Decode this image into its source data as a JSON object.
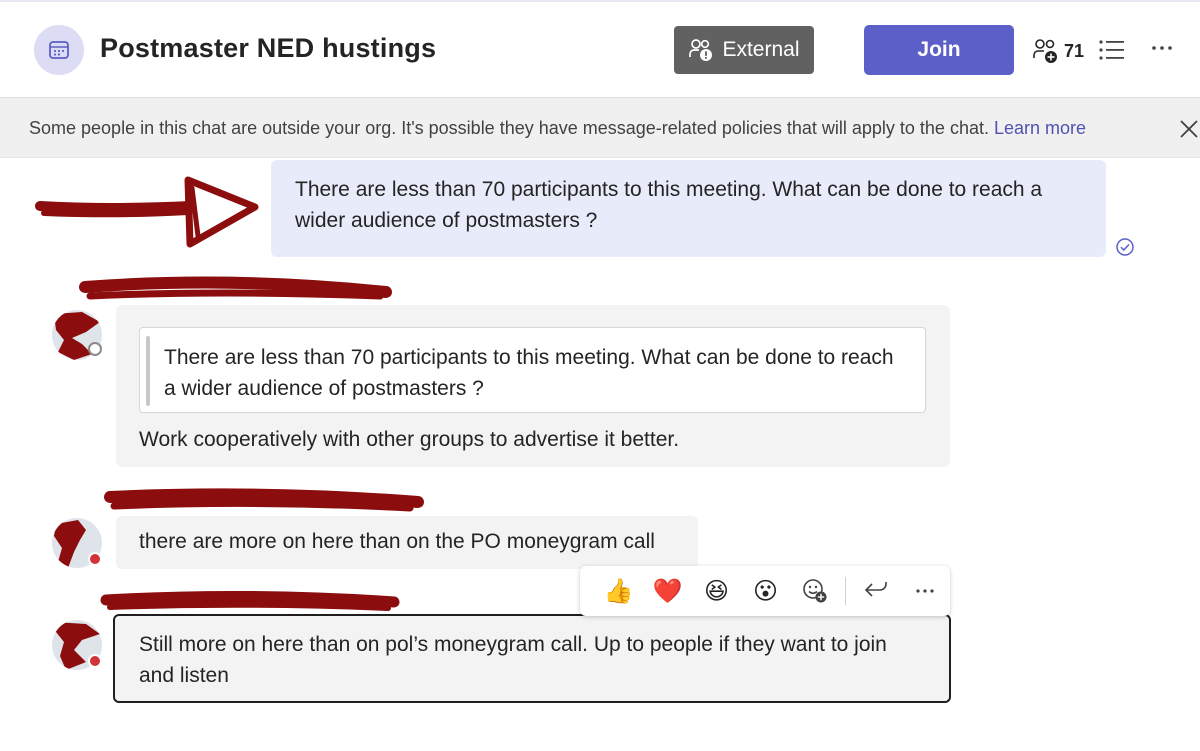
{
  "header": {
    "title": "Postmaster NED hustings",
    "external_label": "External",
    "join_label": "Join",
    "participant_count": "71"
  },
  "banner": {
    "text": "Some people in this chat are outside your org. It's possible they have message-related policies that will apply to the chat.",
    "link": "Learn more"
  },
  "messages": {
    "own": "There are less than 70 participants to this meeting.  What can be done to reach a wider audience of postmasters ?",
    "reply1_quote": "There are less than 70 participants to this meeting. What can be done to reach a wider audience of postmasters ?",
    "reply1_text": "Work cooperatively with other groups to advertise it better.",
    "reply2_text": "there are more on here than on the PO moneygram call",
    "reply3_text": "Still more on here than on pol’s moneygram call. Up to people if they want to join and listen"
  },
  "reactions": [
    "👍",
    "❤️",
    "😆",
    "😮"
  ],
  "colors": {
    "accent": "#5b5fc7",
    "own_bubble": "#e8ebfa",
    "external_badge": "#616161",
    "redaction": "#8b0d0d",
    "presence_busy": "#d13438"
  },
  "icons": {
    "chat_avatar": "calendar-icon",
    "external": "external-people-icon",
    "participants": "people-add-icon",
    "list": "list-icon",
    "more": "more-icon",
    "close": "close-icon",
    "read": "read-receipt-icon",
    "add_reaction": "add-reaction-icon",
    "reply": "reply-icon"
  }
}
